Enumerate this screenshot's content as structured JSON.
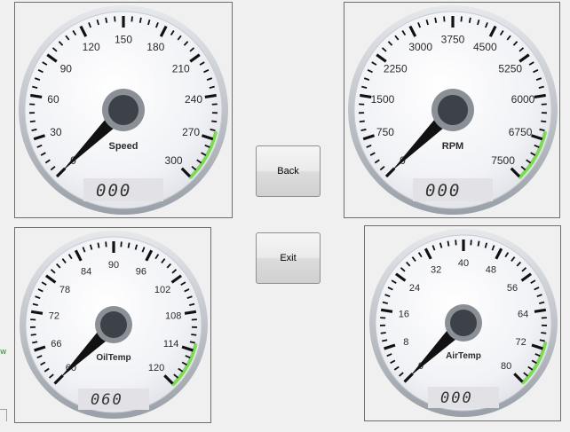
{
  "gauges": [
    {
      "id": "speed",
      "label": "Speed",
      "ticks": [
        "0",
        "30",
        "60",
        "90",
        "120",
        "150",
        "180",
        "210",
        "240",
        "270",
        "300"
      ],
      "value": 0,
      "min": 0,
      "max": 300,
      "display": "000"
    },
    {
      "id": "rpm",
      "label": "RPM",
      "ticks": [
        "0",
        "750",
        "1500",
        "2250",
        "3000",
        "3750",
        "4500",
        "5250",
        "6000",
        "6750",
        "7500"
      ],
      "value": 0,
      "min": 0,
      "max": 7500,
      "display": "000"
    },
    {
      "id": "oiltemp",
      "label": "OilTemp",
      "ticks": [
        "60",
        "66",
        "72",
        "78",
        "84",
        "90",
        "96",
        "102",
        "108",
        "114",
        "120"
      ],
      "value": 60,
      "min": 60,
      "max": 120,
      "display": "060"
    },
    {
      "id": "airtemp",
      "label": "AirTemp",
      "ticks": [
        "0",
        "8",
        "16",
        "24",
        "32",
        "40",
        "48",
        "56",
        "64",
        "72",
        "80"
      ],
      "value": 0,
      "min": 0,
      "max": 80,
      "display": "000"
    }
  ],
  "buttons": {
    "back": "Back",
    "exit": "Exit"
  },
  "edge_glyph": "w",
  "colors": {
    "needle": "#111111",
    "hub": "#3c4248",
    "redline": "#7ed957",
    "lcd_bg": "#e2e2e6",
    "lcd_text": "#333333"
  }
}
